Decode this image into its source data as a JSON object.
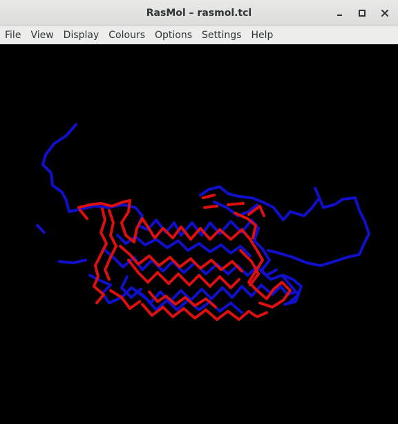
{
  "window": {
    "title": "RasMol – rasmol.tcl",
    "controls": [
      "minimize-icon",
      "maximize-icon",
      "close-icon"
    ]
  },
  "menubar": {
    "items": [
      "File",
      "View",
      "Display",
      "Colours",
      "Options",
      "Settings",
      "Help"
    ]
  },
  "viewport": {
    "background_color": "#000000",
    "chain_colors": {
      "chain_a": "#1010cc",
      "chain_b": "#dd1010"
    }
  }
}
